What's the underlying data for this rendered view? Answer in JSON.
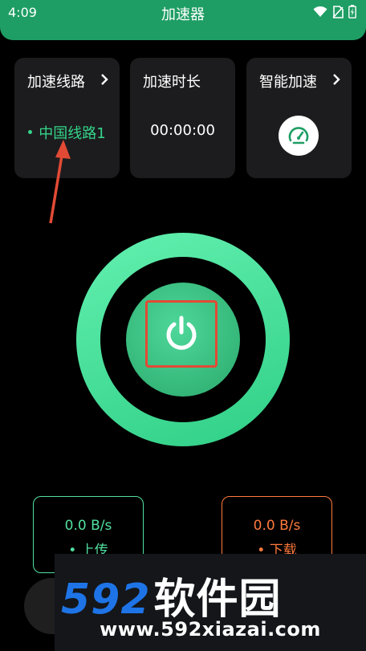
{
  "status_bar": {
    "time": "4:09"
  },
  "app": {
    "title": "加速器"
  },
  "cards": {
    "route": {
      "title": "加速线路",
      "value": "中国线路1"
    },
    "duration": {
      "title": "加速时长",
      "value": "00:00:00"
    },
    "smart": {
      "title": "智能加速"
    }
  },
  "speeds": {
    "upload": {
      "value": "0.0 B/s",
      "label": "• 上传"
    },
    "download": {
      "value": "0.0 B/s",
      "label": "• 下载"
    }
  },
  "watermark": {
    "digits": "592",
    "name": "软件园",
    "url": "www.592xiazai.com"
  },
  "colors": {
    "brand_green": "#1e9e64",
    "accent_green": "#34d58a",
    "download_orange": "#ff7a3d",
    "highlight_red": "#e24a35"
  },
  "icons": [
    "wifi-icon",
    "no-sim-icon",
    "battery-icon",
    "chevron-right-icon",
    "speedometer-icon",
    "power-icon",
    "arrow-annotation"
  ]
}
